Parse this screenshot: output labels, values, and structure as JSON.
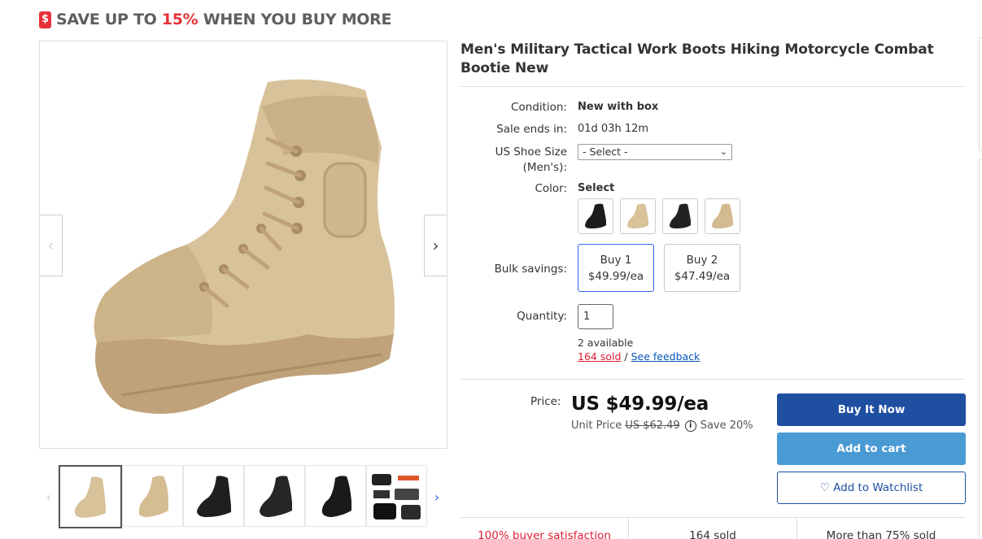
{
  "promo": {
    "tag_symbol": "$",
    "text_before": "SAVE UP TO ",
    "percent": "15%",
    "text_after": " WHEN YOU BUY MORE",
    "accent_color": "#e53238"
  },
  "listing": {
    "title": "Men's Military Tactical Work Boots Hiking Motorcycle Combat Bootie New"
  },
  "gallery": {
    "prev_icon": "‹",
    "next_icon": "›",
    "thumb_prev_icon": "‹",
    "thumb_next_icon": "›",
    "thumbnails": [
      "tan-boot-side",
      "tan-boot-angle",
      "black-boot-side",
      "black-boot-angle",
      "black-boot-front",
      "boot-detail-collage"
    ]
  },
  "details": {
    "condition_label": "Condition:",
    "condition_value": "New with box",
    "sale_label": "Sale ends in:",
    "sale_value": "01d 03h 12m",
    "size_label_1": "US Shoe Size",
    "size_label_2": "(Men's):",
    "size_select_value": "- Select -",
    "color_label": "Color:",
    "color_value": "Select",
    "color_swatches": [
      "black",
      "tan",
      "black",
      "tan"
    ],
    "bulk_label": "Bulk savings:",
    "bulk_options": [
      {
        "qty": "Buy 1",
        "price": "$49.99/ea",
        "selected": true
      },
      {
        "qty": "Buy 2",
        "price": "$47.49/ea",
        "selected": false
      }
    ],
    "quantity_label": "Quantity:",
    "quantity_value": "1",
    "available": "2 available",
    "sold": "164 sold",
    "separator": " / ",
    "feedback": "See feedback"
  },
  "pricing": {
    "price_label": "Price:",
    "price": "US $49.99/ea",
    "unit_label": "Unit Price",
    "original_price": "US $62.49",
    "info_icon": "i",
    "savings": "Save 20%"
  },
  "actions": {
    "buy_now": "Buy It Now",
    "add_to_cart": "Add to cart",
    "watch_icon": "♡",
    "add_to_watchlist": "Add to Watchlist",
    "primary_color": "#1f4fa1",
    "cart_color": "#4a9ad4"
  },
  "stats": {
    "satisfaction": "100% buyer satisfaction",
    "sold": "164 sold",
    "more_than": "More than 75% sold"
  }
}
